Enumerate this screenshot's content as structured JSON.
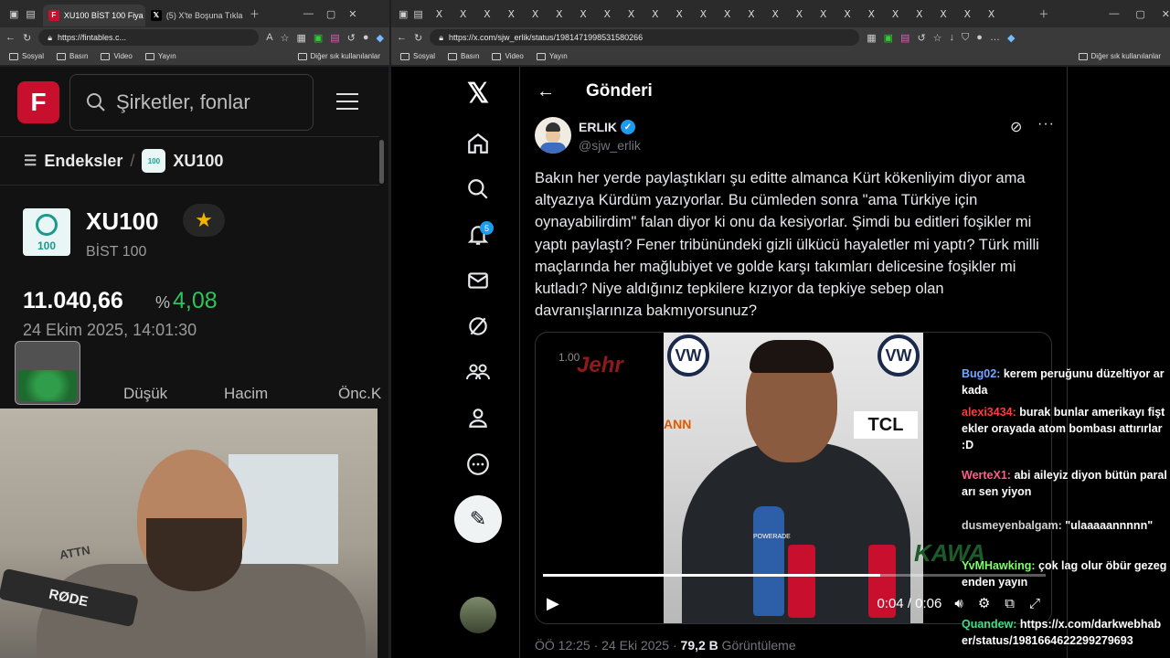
{
  "left_browser": {
    "tabs": [
      {
        "label": "XU100 BİST 100 Fiya",
        "active": true
      },
      {
        "label": "(5) X'te Boşuna Tıkla",
        "active": false
      }
    ],
    "url": "https://fintables.c...",
    "bookmarks": [
      "Sosyal",
      "Basın",
      "Video",
      "Yayın"
    ],
    "other_bookmarks": "Diğer sık kullanılanlar"
  },
  "fintables": {
    "logo_letter": "F",
    "search_placeholder": "Şirketler, fonlar",
    "breadcrumb": {
      "parent": "Endeksler",
      "current": "XU100"
    },
    "index_name": "XU100",
    "index_sub": "BİST 100",
    "logo_text": "100",
    "price": "11.040,66",
    "pct_symbol": "%",
    "change_pct": "4,08",
    "timestamp": "24 Ekim 2025, 14:01:30",
    "columns": [
      "Düşük",
      "Hacim",
      "Önc.K"
    ]
  },
  "webcam": {
    "mic_brand": "RØDE",
    "tattoo": "ATTN"
  },
  "right_browser": {
    "url": "https://x.com/sjw_erlik/status/1981471998531580266",
    "bookmarks": [
      "Sosyal",
      "Basın",
      "Video",
      "Yayın"
    ],
    "other_bookmarks": "Diğer sık kullanılanlar"
  },
  "x": {
    "notif_count": "5",
    "header": "Gönderi",
    "author_name": "ERLIK",
    "author_handle": "@sjw_erlik",
    "post_text": "Bakın her yerde paylaştıkları şu editte almanca Kürt kökenliyim diyor ama altyazıya Kürdüm yazıyorlar. Bu cümleden sonra \"ama Türkiye için oynayabilirdim\" falan diyor ki onu da kesiyorlar. Şimdi bu editleri foşikler mi yaptı paylaştı? Fener tribünündeki gizli ülkücü hayaletler mi yaptı? Türk milli maçlarında her mağlubiyet ve golde karşı takımları delicesine foşikler mi kutladı? Niye aldığınız tepkilere kızıyor da tepkiye sebep olan davranışlarınıza bakmıyorsunuz?",
    "video": {
      "speed": "1.00",
      "watermark_top": "Jehr",
      "watermark_bottom": "KAWA",
      "sponsor": "TCL",
      "sponsor_left": "ANN",
      "bottle_text": "POWERADE",
      "time": "0:04 / 0:06",
      "progress": 0.67
    },
    "post_time": "ÖÖ 12:25 · 24 Eki 2025 · ",
    "views": "79,2 B",
    "views_label": " Görüntüleme"
  },
  "chat": [
    {
      "user": "Bug02",
      "color": "#6fa8ff",
      "text": "kerem peruğunu düzeltiyor arkada"
    },
    {
      "user": "alexi3434",
      "color": "#ff3b3b",
      "text": "burak bunlar amerikayı fiştekler orayada atom bombası attırırlar :D"
    },
    {
      "user": "WerteX1",
      "color": "#ff5c8a",
      "text": "abi aileyiz diyon bütün paraları sen yiyon"
    },
    {
      "user": "dusmeyenbalgam",
      "color": "#d0d0d0",
      "text": "\"ulaaaaannnnn\""
    },
    {
      "user": "YvMHawking",
      "color": "#7dff6a",
      "text": "çok lag olur öbür gezegenden yayın"
    },
    {
      "user": "Quandew",
      "color": "#3fe08a",
      "text": "https://x.com/darkwebhaber/status/1981664622299279693"
    }
  ],
  "colors": {
    "accent": "#1d9bf0",
    "fintables_red": "#c8102e",
    "up_green": "#2ec45a"
  }
}
